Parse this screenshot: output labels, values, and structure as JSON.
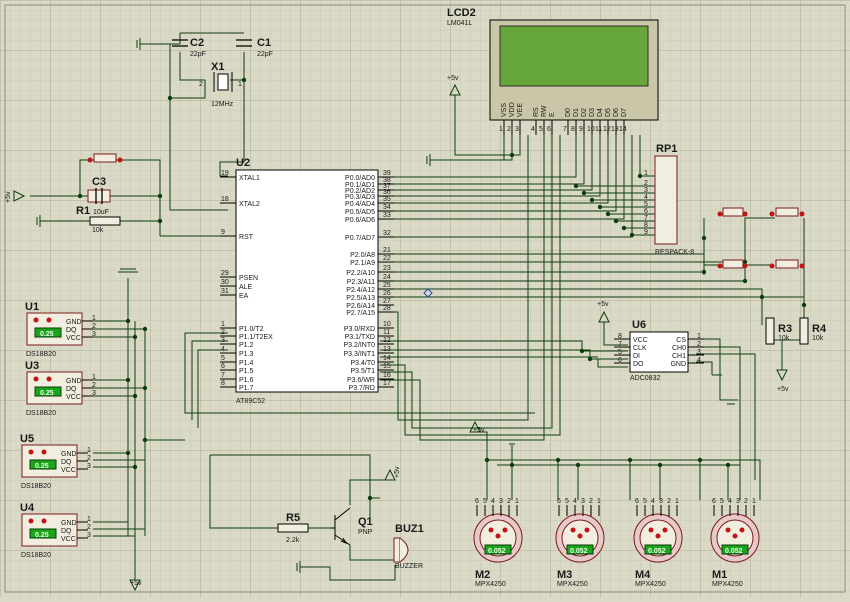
{
  "lcd": {
    "ref": "LCD2",
    "model": "LM041L",
    "pins": [
      "VSS",
      "VDD",
      "VEE",
      "RS",
      "RW",
      "E",
      "D0",
      "D1",
      "D2",
      "D3",
      "D4",
      "D5",
      "D6",
      "D7"
    ],
    "pin_numbers": [
      "1",
      "2",
      "3",
      "4",
      "5",
      "6",
      "7",
      "8",
      "9",
      "10",
      "11",
      "12",
      "13",
      "14"
    ]
  },
  "mcu": {
    "ref": "U2",
    "model": "AT89C52",
    "left_pins": [
      {
        "name": "XTAL1",
        "num": "19"
      },
      {
        "name": "XTAL2",
        "num": "18"
      },
      {
        "name": "RST",
        "num": "9"
      },
      {
        "name": "PSEN",
        "num": "29"
      },
      {
        "name": "ALE",
        "num": "30"
      },
      {
        "name": "EA",
        "num": "31"
      },
      {
        "name": "P1.0/T2",
        "num": "1"
      },
      {
        "name": "P1.1/T2EX",
        "num": "2"
      },
      {
        "name": "P1.2",
        "num": "3"
      },
      {
        "name": "P1.3",
        "num": "4"
      },
      {
        "name": "P1.4",
        "num": "5"
      },
      {
        "name": "P1.5",
        "num": "6"
      },
      {
        "name": "P1.6",
        "num": "7"
      },
      {
        "name": "P1.7",
        "num": "8"
      }
    ],
    "right_pins": [
      {
        "name": "P0.0/AD0",
        "num": "39"
      },
      {
        "name": "P0.1/AD1",
        "num": "38"
      },
      {
        "name": "P0.2/AD2",
        "num": "37"
      },
      {
        "name": "P0.3/AD3",
        "num": "36"
      },
      {
        "name": "P0.4/AD4",
        "num": "35"
      },
      {
        "name": "P0.5/AD5",
        "num": "34"
      },
      {
        "name": "P0.6/AD6",
        "num": "33"
      },
      {
        "name": "P0.7/AD7",
        "num": "32"
      },
      {
        "name": "P2.0/A8",
        "num": "21"
      },
      {
        "name": "P2.1/A9",
        "num": "22"
      },
      {
        "name": "P2.2/A10",
        "num": "23"
      },
      {
        "name": "P2.3/A11",
        "num": "24"
      },
      {
        "name": "P2.4/A12",
        "num": "25"
      },
      {
        "name": "P2.5/A13",
        "num": "26"
      },
      {
        "name": "P2.6/A14",
        "num": "27"
      },
      {
        "name": "P2.7/A15",
        "num": "28"
      },
      {
        "name": "P3.0/RXD",
        "num": "10"
      },
      {
        "name": "P3.1/TXD",
        "num": "11"
      },
      {
        "name": "P3.2/INT0",
        "num": "12"
      },
      {
        "name": "P3.3/INT1",
        "num": "13"
      },
      {
        "name": "P3.4/T0",
        "num": "14"
      },
      {
        "name": "P3.5/T1",
        "num": "15"
      },
      {
        "name": "P3.6/WR",
        "num": "16"
      },
      {
        "name": "P3.7/RD",
        "num": "17"
      }
    ]
  },
  "caps": {
    "c1_ref": "C1",
    "c1_val": "22pF",
    "c2_ref": "C2",
    "c2_val": "22pF",
    "c3_ref": "C3",
    "c3_val": "10uF"
  },
  "crystal": {
    "ref": "X1",
    "val": "12MHz",
    "pin1": "1",
    "pin2": "2"
  },
  "resistors": {
    "r1_ref": "R1",
    "r1_val": "10k",
    "r3_ref": "R3",
    "r3_val": "10k",
    "r4_ref": "R4",
    "r4_val": "10k",
    "r5_ref": "R5",
    "r5_val": "2.2k"
  },
  "rpack": {
    "ref": "RP1",
    "model": "RESPACK-8",
    "pins": [
      "1",
      "2",
      "3",
      "4",
      "5",
      "6",
      "7",
      "8",
      "9"
    ]
  },
  "adc": {
    "ref": "U6",
    "model": "ADC0832",
    "left_pins": [
      {
        "name": "VCC",
        "num": "8"
      },
      {
        "name": "CLK",
        "num": "7"
      },
      {
        "name": "DI",
        "num": "5"
      },
      {
        "name": "DO",
        "num": "6"
      }
    ],
    "right_pins": [
      {
        "name": "CS",
        "num": "1"
      },
      {
        "name": "CH0",
        "num": "2"
      },
      {
        "name": "CH1",
        "num": "3"
      },
      {
        "name": "GND",
        "num": "4"
      }
    ]
  },
  "sensors": [
    {
      "ref": "U1",
      "model": "DS18B20",
      "display": "0.25"
    },
    {
      "ref": "U3",
      "model": "DS18B20",
      "display": "0.25"
    },
    {
      "ref": "U5",
      "model": "DS18B20",
      "display": "0.25"
    },
    {
      "ref": "U4",
      "model": "DS18B20",
      "display": "0.25"
    }
  ],
  "sensor_pins": [
    {
      "name": "GND",
      "num": "1"
    },
    {
      "name": "DQ",
      "num": "2"
    },
    {
      "name": "VCC",
      "num": "3"
    }
  ],
  "pressure": [
    {
      "ref": "M2",
      "model": "MPX4250",
      "display": "0.052"
    },
    {
      "ref": "M3",
      "model": "MPX4250",
      "display": "0.052"
    },
    {
      "ref": "M4",
      "model": "MPX4250",
      "display": "0.052"
    },
    {
      "ref": "M1",
      "model": "MPX4250",
      "display": "0.052"
    }
  ],
  "pressure_pins": [
    "6",
    "5",
    "4",
    "3",
    "2",
    "1"
  ],
  "transistor": {
    "ref": "Q1",
    "type": "PNP"
  },
  "buzzer": {
    "ref": "BUZ1",
    "label": "BUZZER"
  },
  "power": {
    "vcc": "+5v"
  }
}
